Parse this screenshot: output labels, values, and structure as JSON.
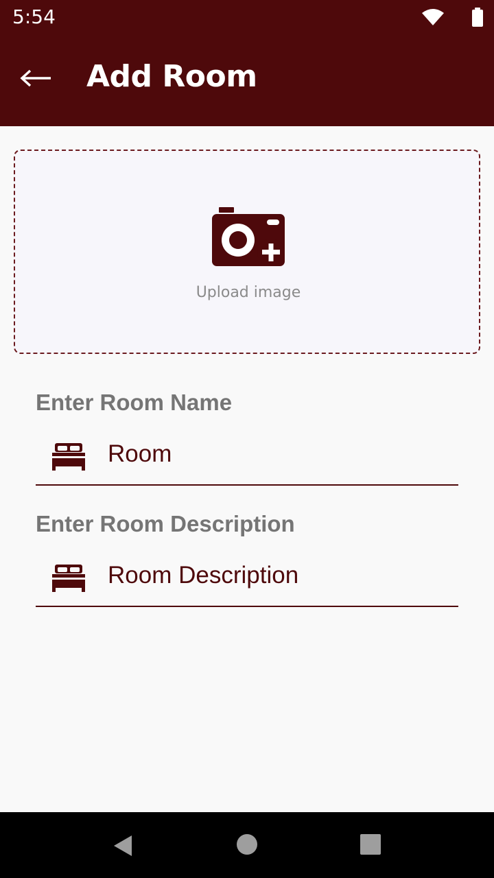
{
  "status_bar": {
    "time": "5:54",
    "icons": [
      "wifi-icon",
      "battery-icon"
    ]
  },
  "app_bar": {
    "back_icon": "arrow-left-icon",
    "title": "Add Room"
  },
  "upload": {
    "icon": "camera-add-icon",
    "label": "Upload image"
  },
  "form": {
    "room_name": {
      "label": "Enter Room Name",
      "icon": "bed-icon",
      "value": "Room"
    },
    "room_description": {
      "label": "Enter Room Description",
      "icon": "bed-icon",
      "value": "Room Description"
    }
  },
  "nav_bar": {
    "buttons": [
      "back-triangle-icon",
      "home-circle-icon",
      "recents-square-icon"
    ]
  },
  "colors": {
    "primary": "#4e090b",
    "background": "#f9f9f9",
    "label_gray": "#757575",
    "upload_bg": "#f7f6fb"
  }
}
